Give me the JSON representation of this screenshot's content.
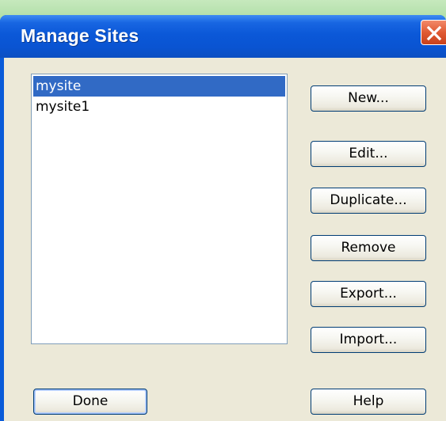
{
  "window": {
    "title": "Manage Sites"
  },
  "icons": {
    "close": "close-icon"
  },
  "sites": {
    "items": [
      {
        "label": "mysite",
        "selected": true
      },
      {
        "label": "mysite1",
        "selected": false
      }
    ]
  },
  "buttons": {
    "new": "New...",
    "edit": "Edit...",
    "duplicate": "Duplicate...",
    "remove": "Remove",
    "export": "Export...",
    "import": "Import...",
    "done": "Done",
    "help": "Help"
  },
  "colors": {
    "titlebar": "#0a54d2",
    "selection": "#316ac5",
    "dialog_bg": "#ece9d8",
    "close_button": "#e05a33"
  }
}
